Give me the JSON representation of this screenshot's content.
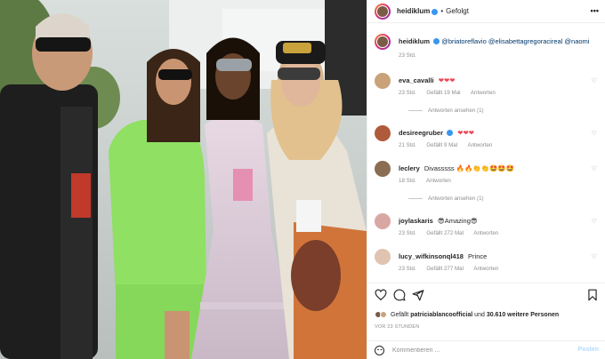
{
  "post": {
    "author": "heidiklum",
    "follow_label": "Gefolgt",
    "separator": "•",
    "caption_mentions": "@briatoreflavio @elisabettagregoraci​real @naomi",
    "caption_heart": "❤",
    "caption_time": "23 Std."
  },
  "comments": [
    {
      "user": "eva_cavalli",
      "text": "❤❤❤",
      "time": "23 Std.",
      "likes": "Gefällt 19 Mal",
      "reply": "Antworten",
      "avatar_color": "#c9a27a",
      "text_color": "#ed4956"
    },
    {
      "user": "desireegruber",
      "text": "❤❤❤",
      "time": "21 Std.",
      "likes": "Gefällt 9 Mal",
      "reply": "Antworten",
      "avatar_color": "#b05a3c",
      "text_color": "#ed4956"
    },
    {
      "user": "leclery",
      "text": "Divasssss 🔥🔥👏👏🤩🤩🤩",
      "time": "18 Std.",
      "likes": "",
      "reply": "Antworten",
      "avatar_color": "#8a6d52"
    },
    {
      "user": "joylaskaris",
      "text": "😎Amazing😎",
      "time": "23 Std.",
      "likes": "Gefällt 272 Mal",
      "reply": "Antworten",
      "avatar_color": "#d9a7a3"
    },
    {
      "user": "lucy_wifkinsonql418",
      "text": "Prince",
      "time": "23 Std.",
      "likes": "Gefällt 277 Mal",
      "reply": "Antworten",
      "avatar_color": "#e0c3b0"
    }
  ],
  "reply_threads": [
    {
      "label": "Antworten ansehen (1)"
    },
    {
      "label": "Antworten ansehen (1)"
    }
  ],
  "footer": {
    "liked_by_prefix": "Gefällt",
    "liked_by_user": "patriciablancoofficial",
    "liked_by_suffix": "und",
    "liked_by_count": "30.610 weitere Personen",
    "time_ago": "VOR 23 STUNDEN",
    "comment_placeholder": "Kommentieren ...",
    "post_label": "Posten"
  },
  "icons": {
    "more": "more-icon",
    "like": "heart-icon",
    "comment": "comment-icon",
    "share": "share-icon",
    "save": "bookmark-icon",
    "emoji": "emoji-icon"
  },
  "colors": {
    "accent": "#3897f0",
    "post_disabled": "#b3dbff",
    "meta": "#8e8e8e",
    "heart_red": "#ed4956"
  }
}
